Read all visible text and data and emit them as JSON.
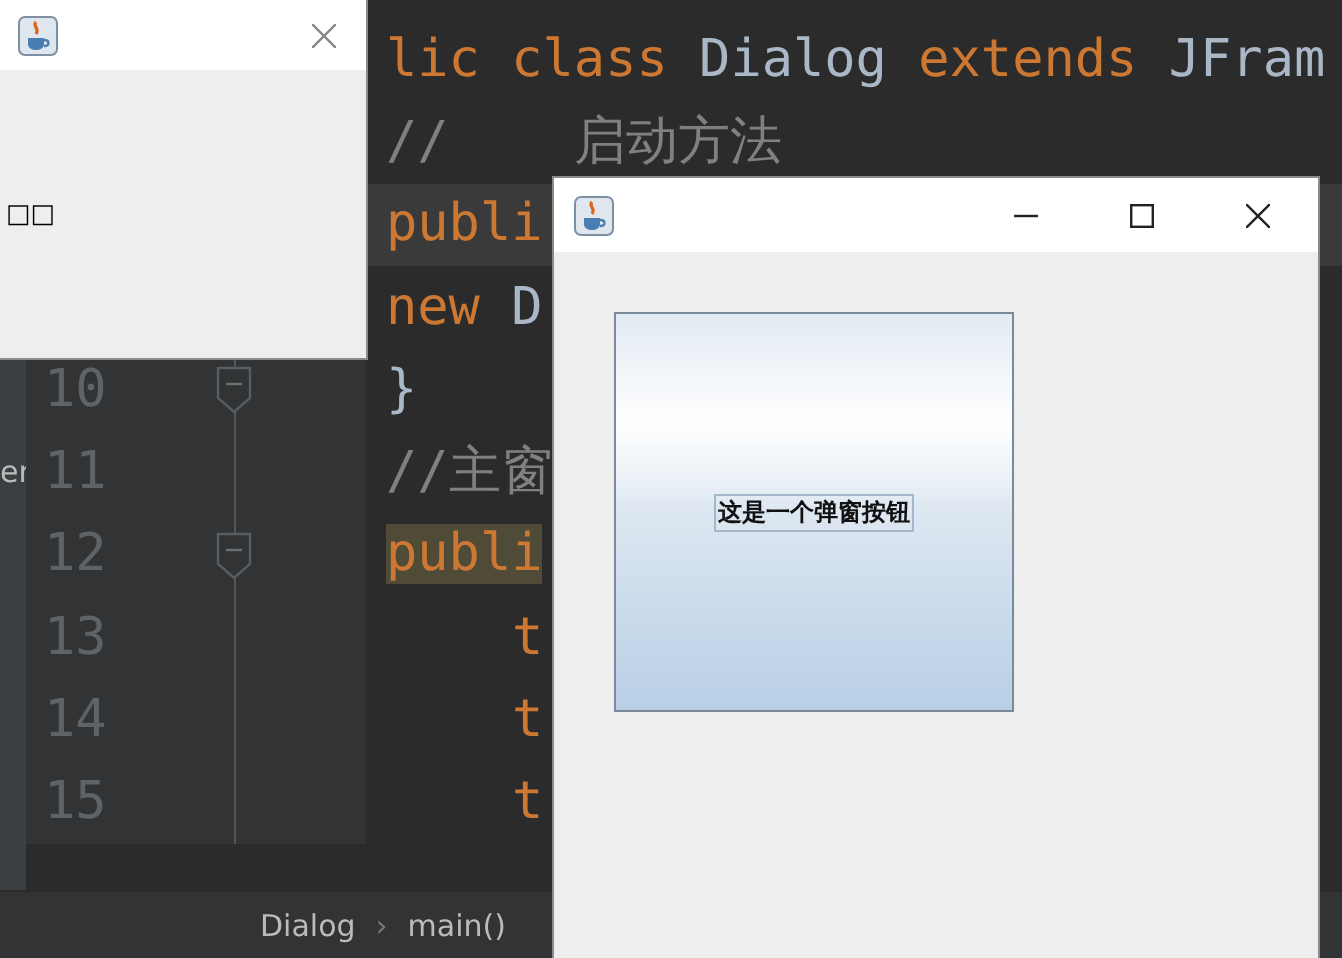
{
  "ide": {
    "sidebar_label": "er",
    "rows": [
      {
        "current": false,
        "indented": false,
        "segments": [
          {
            "kind": "keyword",
            "text": "lic class"
          },
          {
            "kind": "plain",
            "text": " Dialog "
          },
          {
            "kind": "keyword",
            "text": "extends"
          },
          {
            "kind": "plain",
            "text": " JFram"
          }
        ]
      },
      {
        "current": false,
        "indented": false,
        "segments": [
          {
            "kind": "comment",
            "text": "//    启动方法"
          }
        ]
      },
      {
        "current": true,
        "indented": false,
        "segments": [
          {
            "kind": "keyword",
            "text": "publi"
          }
        ]
      },
      {
        "current": false,
        "indented": false,
        "segments": [
          {
            "kind": "keyword",
            "text": "new"
          },
          {
            "kind": "plain",
            "text": " D"
          }
        ]
      },
      {
        "number": "10",
        "current": false,
        "indented": false,
        "fold_marker": true,
        "segments": [
          {
            "kind": "plain",
            "text": "}"
          }
        ]
      },
      {
        "number": "11",
        "current": false,
        "indented": false,
        "fold_marker": false,
        "segments": [
          {
            "kind": "comment",
            "text": "//主窗"
          }
        ]
      },
      {
        "number": "12",
        "current": false,
        "indented": false,
        "fold_marker": true,
        "segments": [
          {
            "kind": "highlight",
            "text": "publi"
          }
        ]
      },
      {
        "number": "13",
        "current": false,
        "indented": true,
        "fold_marker": false,
        "segments": [
          {
            "kind": "keyword",
            "text": "t"
          }
        ]
      },
      {
        "number": "14",
        "current": false,
        "indented": true,
        "fold_marker": false,
        "segments": [
          {
            "kind": "keyword",
            "text": "t"
          }
        ]
      },
      {
        "number": "15",
        "current": false,
        "indented": true,
        "fold_marker": false,
        "segments": [
          {
            "kind": "keyword",
            "text": "t"
          }
        ]
      }
    ],
    "breadcrumbs": [
      "Dialog",
      "main()"
    ],
    "breadcrumb_separator": "›"
  },
  "windows": [
    {
      "kind": "small",
      "buttons": [
        {
          "kind": "close"
        }
      ],
      "content_text": "□□"
    },
    {
      "kind": "main",
      "buttons": [
        {
          "kind": "minimize"
        },
        {
          "kind": "maximize"
        },
        {
          "kind": "close"
        }
      ],
      "button": {
        "label": "这是一个弹窗按钮",
        "focused": true
      }
    }
  ]
}
